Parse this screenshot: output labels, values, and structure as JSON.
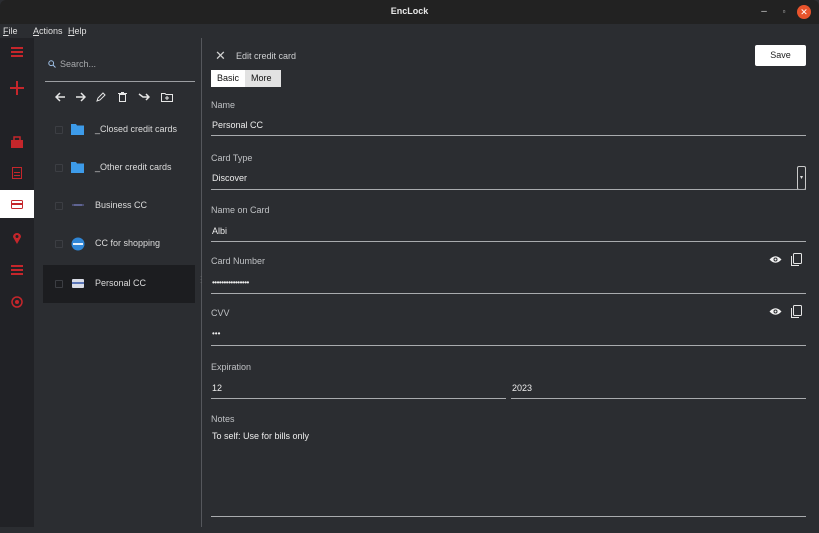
{
  "window": {
    "title": "EncLock"
  },
  "menu": {
    "file": "File",
    "actions": "Actions",
    "help": "Help"
  },
  "search": {
    "placeholder": "Search..."
  },
  "list": {
    "items": [
      {
        "label": "_Closed credit cards"
      },
      {
        "label": "_Other credit cards"
      },
      {
        "label": "Business CC"
      },
      {
        "label": "CC for shopping"
      },
      {
        "label": "Personal CC"
      }
    ]
  },
  "editor": {
    "header": "Edit credit card",
    "save_label": "Save",
    "tabs": {
      "basic": "Basic",
      "more": "More"
    },
    "name_label": "Name",
    "name_value": "Personal CC",
    "card_type_label": "Card Type",
    "card_type_value": "Discover",
    "name_on_card_label": "Name on Card",
    "name_on_card_value": "Albi",
    "card_number_label": "Card Number",
    "card_number_value": "••••••••••••••••",
    "cvv_label": "CVV",
    "cvv_value": "•••",
    "expiration_label": "Expiration",
    "exp_month": "12",
    "exp_year": "2023",
    "notes_label": "Notes",
    "notes_value": "To self: Use for bills only"
  },
  "colors": {
    "accent": "#c5262b",
    "folder": "#3d9be9",
    "close": "#e9542c"
  }
}
